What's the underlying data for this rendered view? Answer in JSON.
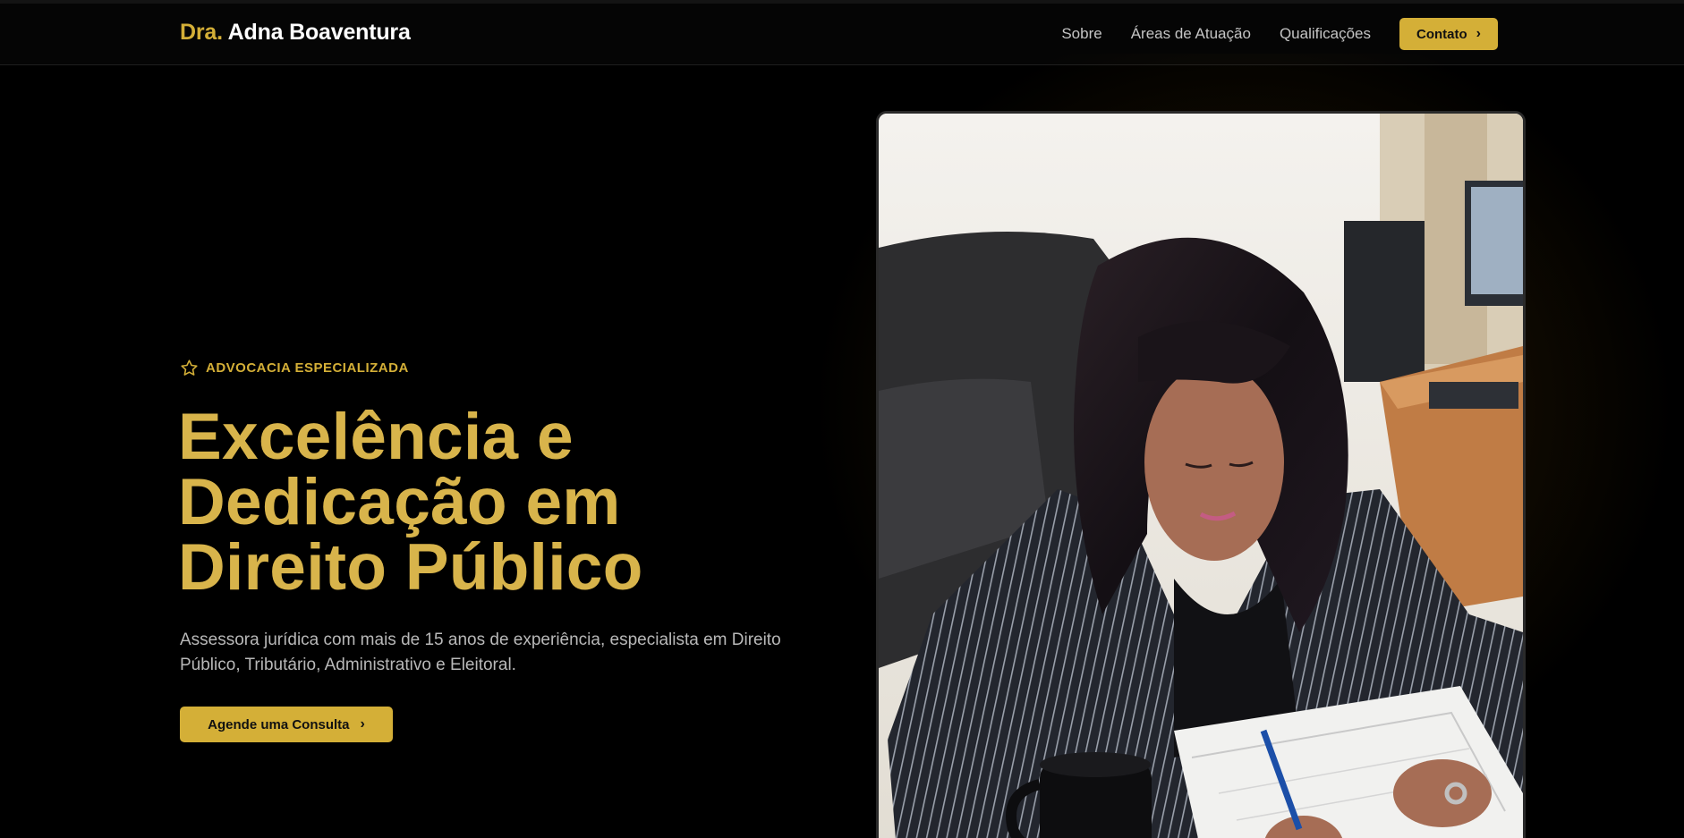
{
  "header": {
    "logo_prefix": "Dra.",
    "logo_name": "Adna Boaventura",
    "nav": [
      {
        "label": "Sobre"
      },
      {
        "label": "Áreas de Atuação"
      },
      {
        "label": "Qualificações"
      }
    ],
    "contact_label": "Contato"
  },
  "hero": {
    "badge": "ADVOCACIA ESPECIALIZADA",
    "headline": [
      "Excelência e",
      "Dedicação em",
      "Direito Público"
    ],
    "lead": "Assessora jurídica com mais de 15 anos de experiência, especialista em Direito Público, Tributário, Administrativo e Eleitoral.",
    "cta_label": "Agende uma Consulta"
  },
  "icons": {
    "badge": "star-icon",
    "buttons": "chevron-right-icon"
  },
  "colors": {
    "accent": "#d4af37",
    "background": "#000000",
    "text_muted": "#b8b8b8"
  }
}
